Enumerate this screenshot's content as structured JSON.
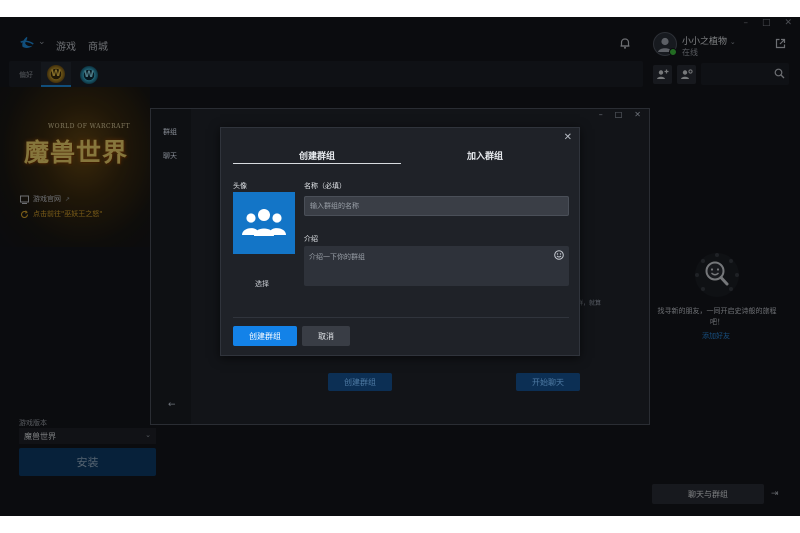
{
  "window": {
    "controls": [
      "–",
      "□",
      "✕"
    ]
  },
  "nav": {
    "items": [
      "游戏",
      "商城"
    ]
  },
  "user": {
    "name": "小小之植物",
    "status": "在线"
  },
  "favorites": {
    "label": "偏好"
  },
  "game": {
    "title_sub": "WORLD OF WARCRAFT",
    "title_main": "魔兽世界",
    "links": [
      "游戏官网",
      "点击前往\"巫妖王之怒\""
    ],
    "version_label": "游戏版本",
    "version_value": "魔兽世界",
    "install_label": "安装"
  },
  "friends": {
    "empty_text": "找寻新的朋友，一同开启史诗般的旅程吧！",
    "add_friend": "添加好友",
    "chat_button": "聊天与群组",
    "collapse_icon": "⇥"
  },
  "inner_window": {
    "controls": [
      "–",
      "□",
      "✕"
    ],
    "tabs": [
      "群组",
      "聊天"
    ],
    "back_icon": "←",
    "create_button": "创建群组",
    "start_chat_button": "开始聊天",
    "fragment": "群，就算"
  },
  "modal": {
    "tabs": [
      "创建群组",
      "加入群组"
    ],
    "avatar_label": "头像",
    "avatar_select": "选择",
    "name_label": "名称（必填）",
    "name_placeholder": "输入群组的名称",
    "intro_label": "介绍",
    "intro_placeholder": "介绍一下你的群组",
    "create_button": "创建群组",
    "cancel_button": "取消",
    "close_icon": "✕"
  },
  "colors": {
    "accent": "#1382e8",
    "online": "#3ec43e",
    "gold": "#e0a92c",
    "link": "#2b8fe6"
  }
}
